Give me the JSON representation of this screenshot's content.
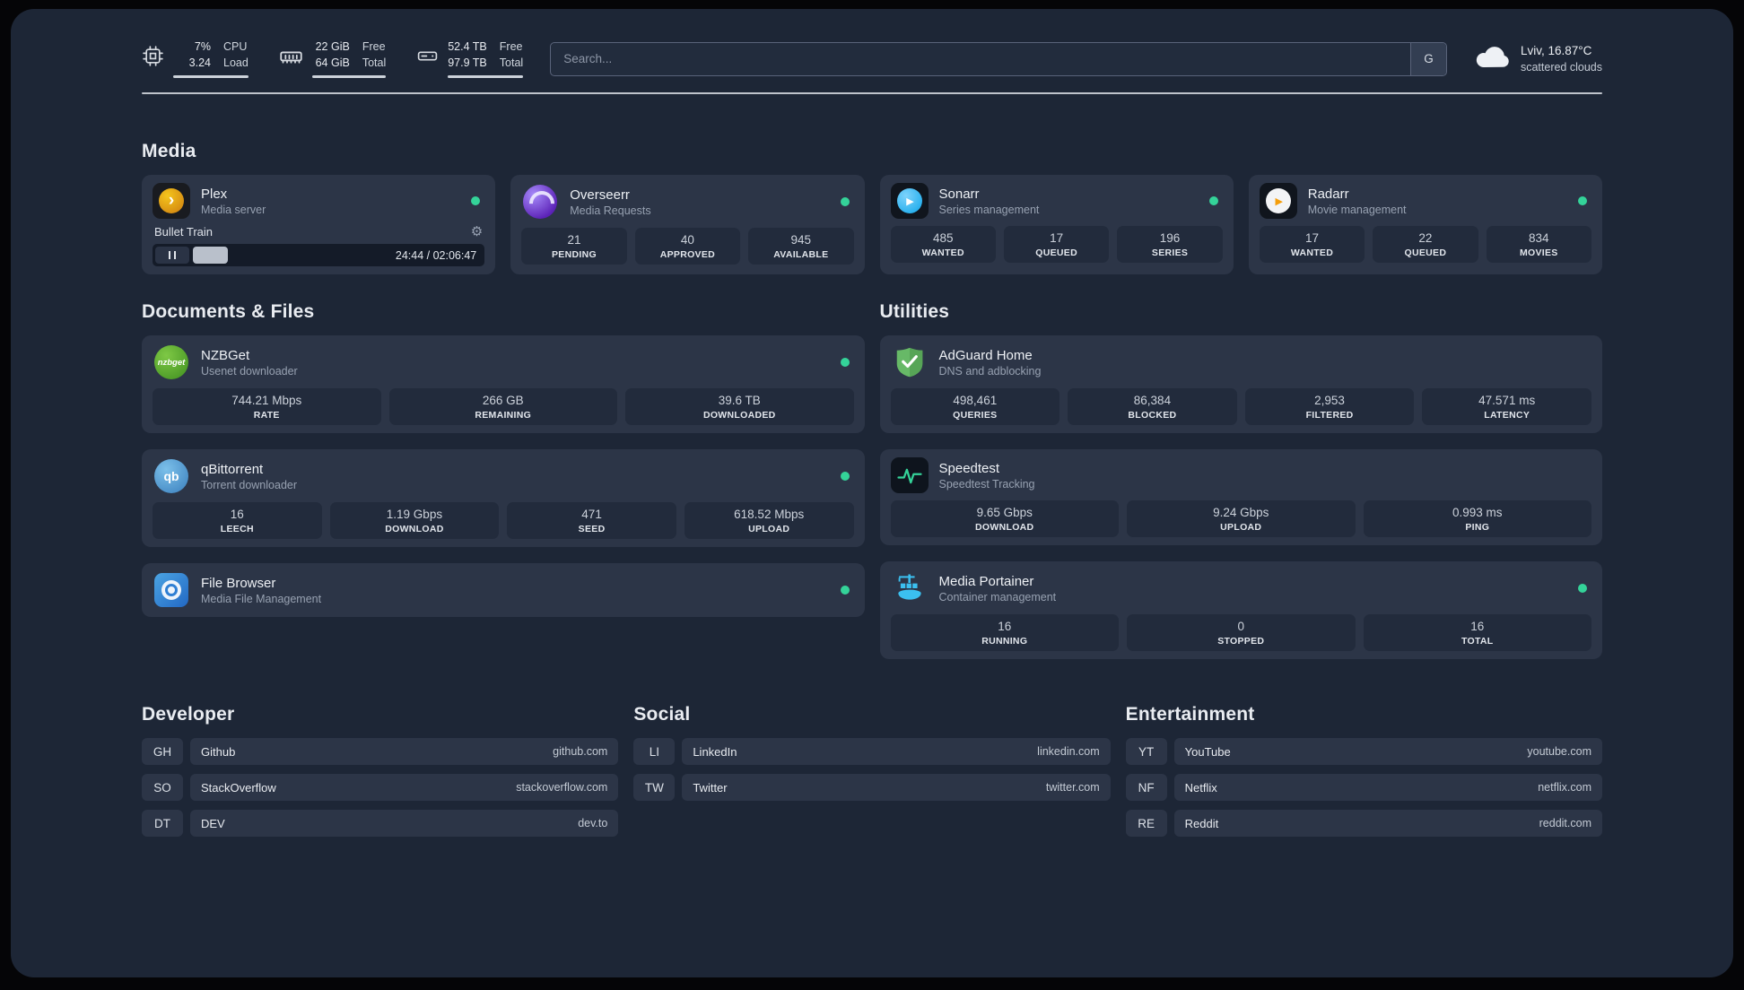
{
  "theme": {
    "background": "#1d2636",
    "card": "#2c3547",
    "stat_box": "#222b3c",
    "status_green": "#34d399",
    "plex_amber": "#e5a00d",
    "overseerr_purple": "#7c3aed",
    "sonarr_blue": "#0ea5e9",
    "radarr_amber": "#f59e0b",
    "nzbget_green": "#5aa52f",
    "qbittorrent_blue": "#5a9fd4",
    "filebrowser_blue": "#2f7fd3",
    "adguard_green": "#67b967",
    "portainer_blue": "#3bc0f0"
  },
  "topbar": {
    "cpu": {
      "value1": "7%",
      "value2": "3.24",
      "label1": "CPU",
      "label2": "Load"
    },
    "memory": {
      "value1": "22 GiB",
      "value2": "64 GiB",
      "label1": "Free",
      "label2": "Total"
    },
    "disk": {
      "value1": "52.4 TB",
      "value2": "97.9 TB",
      "label1": "Free",
      "label2": "Total"
    },
    "search": {
      "placeholder": "Search...",
      "button_label": "G"
    },
    "weather": {
      "location": "Lviv, 16.87°C",
      "condition": "scattered clouds"
    }
  },
  "sections": {
    "media": "Media",
    "documents": "Documents & Files",
    "utilities": "Utilities",
    "developer": "Developer",
    "social": "Social",
    "entertainment": "Entertainment"
  },
  "services": {
    "plex": {
      "name": "Plex",
      "subtitle": "Media server",
      "player": {
        "title": "Bullet Train",
        "time": "24:44 / 02:06:47"
      }
    },
    "overseerr": {
      "name": "Overseerr",
      "subtitle": "Media Requests",
      "stats": [
        {
          "value": "21",
          "label": "PENDING"
        },
        {
          "value": "40",
          "label": "APPROVED"
        },
        {
          "value": "945",
          "label": "AVAILABLE"
        }
      ]
    },
    "sonarr": {
      "name": "Sonarr",
      "subtitle": "Series management",
      "stats": [
        {
          "value": "485",
          "label": "WANTED"
        },
        {
          "value": "17",
          "label": "QUEUED"
        },
        {
          "value": "196",
          "label": "SERIES"
        }
      ]
    },
    "radarr": {
      "name": "Radarr",
      "subtitle": "Movie management",
      "stats": [
        {
          "value": "17",
          "label": "WANTED"
        },
        {
          "value": "22",
          "label": "QUEUED"
        },
        {
          "value": "834",
          "label": "MOVIES"
        }
      ]
    },
    "nzbget": {
      "name": "NZBGet",
      "subtitle": "Usenet downloader",
      "icon_text": "nzbget",
      "stats": [
        {
          "value": "744.21 Mbps",
          "label": "RATE"
        },
        {
          "value": "266 GB",
          "label": "REMAINING"
        },
        {
          "value": "39.6 TB",
          "label": "DOWNLOADED"
        }
      ]
    },
    "qbittorrent": {
      "name": "qBittorrent",
      "subtitle": "Torrent downloader",
      "icon_text": "qb",
      "stats": [
        {
          "value": "16",
          "label": "LEECH"
        },
        {
          "value": "1.19 Gbps",
          "label": "DOWNLOAD"
        },
        {
          "value": "471",
          "label": "SEED"
        },
        {
          "value": "618.52 Mbps",
          "label": "UPLOAD"
        }
      ]
    },
    "filebrowser": {
      "name": "File Browser",
      "subtitle": "Media File Management"
    },
    "adguard": {
      "name": "AdGuard Home",
      "subtitle": "DNS and adblocking",
      "stats": [
        {
          "value": "498,461",
          "label": "QUERIES"
        },
        {
          "value": "86,384",
          "label": "BLOCKED"
        },
        {
          "value": "2,953",
          "label": "FILTERED"
        },
        {
          "value": "47.571 ms",
          "label": "LATENCY"
        }
      ]
    },
    "speedtest": {
      "name": "Speedtest",
      "subtitle": "Speedtest Tracking",
      "stats": [
        {
          "value": "9.65 Gbps",
          "label": "DOWNLOAD"
        },
        {
          "value": "9.24 Gbps",
          "label": "UPLOAD"
        },
        {
          "value": "0.993 ms",
          "label": "PING"
        }
      ]
    },
    "portainer": {
      "name": "Media Portainer",
      "subtitle": "Container management",
      "stats": [
        {
          "value": "16",
          "label": "RUNNING"
        },
        {
          "value": "0",
          "label": "STOPPED"
        },
        {
          "value": "16",
          "label": "TOTAL"
        }
      ]
    }
  },
  "bookmarks": {
    "developer": [
      {
        "abbr": "GH",
        "name": "Github",
        "url": "github.com"
      },
      {
        "abbr": "SO",
        "name": "StackOverflow",
        "url": "stackoverflow.com"
      },
      {
        "abbr": "DT",
        "name": "DEV",
        "url": "dev.to"
      }
    ],
    "social": [
      {
        "abbr": "LI",
        "name": "LinkedIn",
        "url": "linkedin.com"
      },
      {
        "abbr": "TW",
        "name": "Twitter",
        "url": "twitter.com"
      }
    ],
    "entertainment": [
      {
        "abbr": "YT",
        "name": "YouTube",
        "url": "youtube.com"
      },
      {
        "abbr": "NF",
        "name": "Netflix",
        "url": "netflix.com"
      },
      {
        "abbr": "RE",
        "name": "Reddit",
        "url": "reddit.com"
      }
    ]
  }
}
